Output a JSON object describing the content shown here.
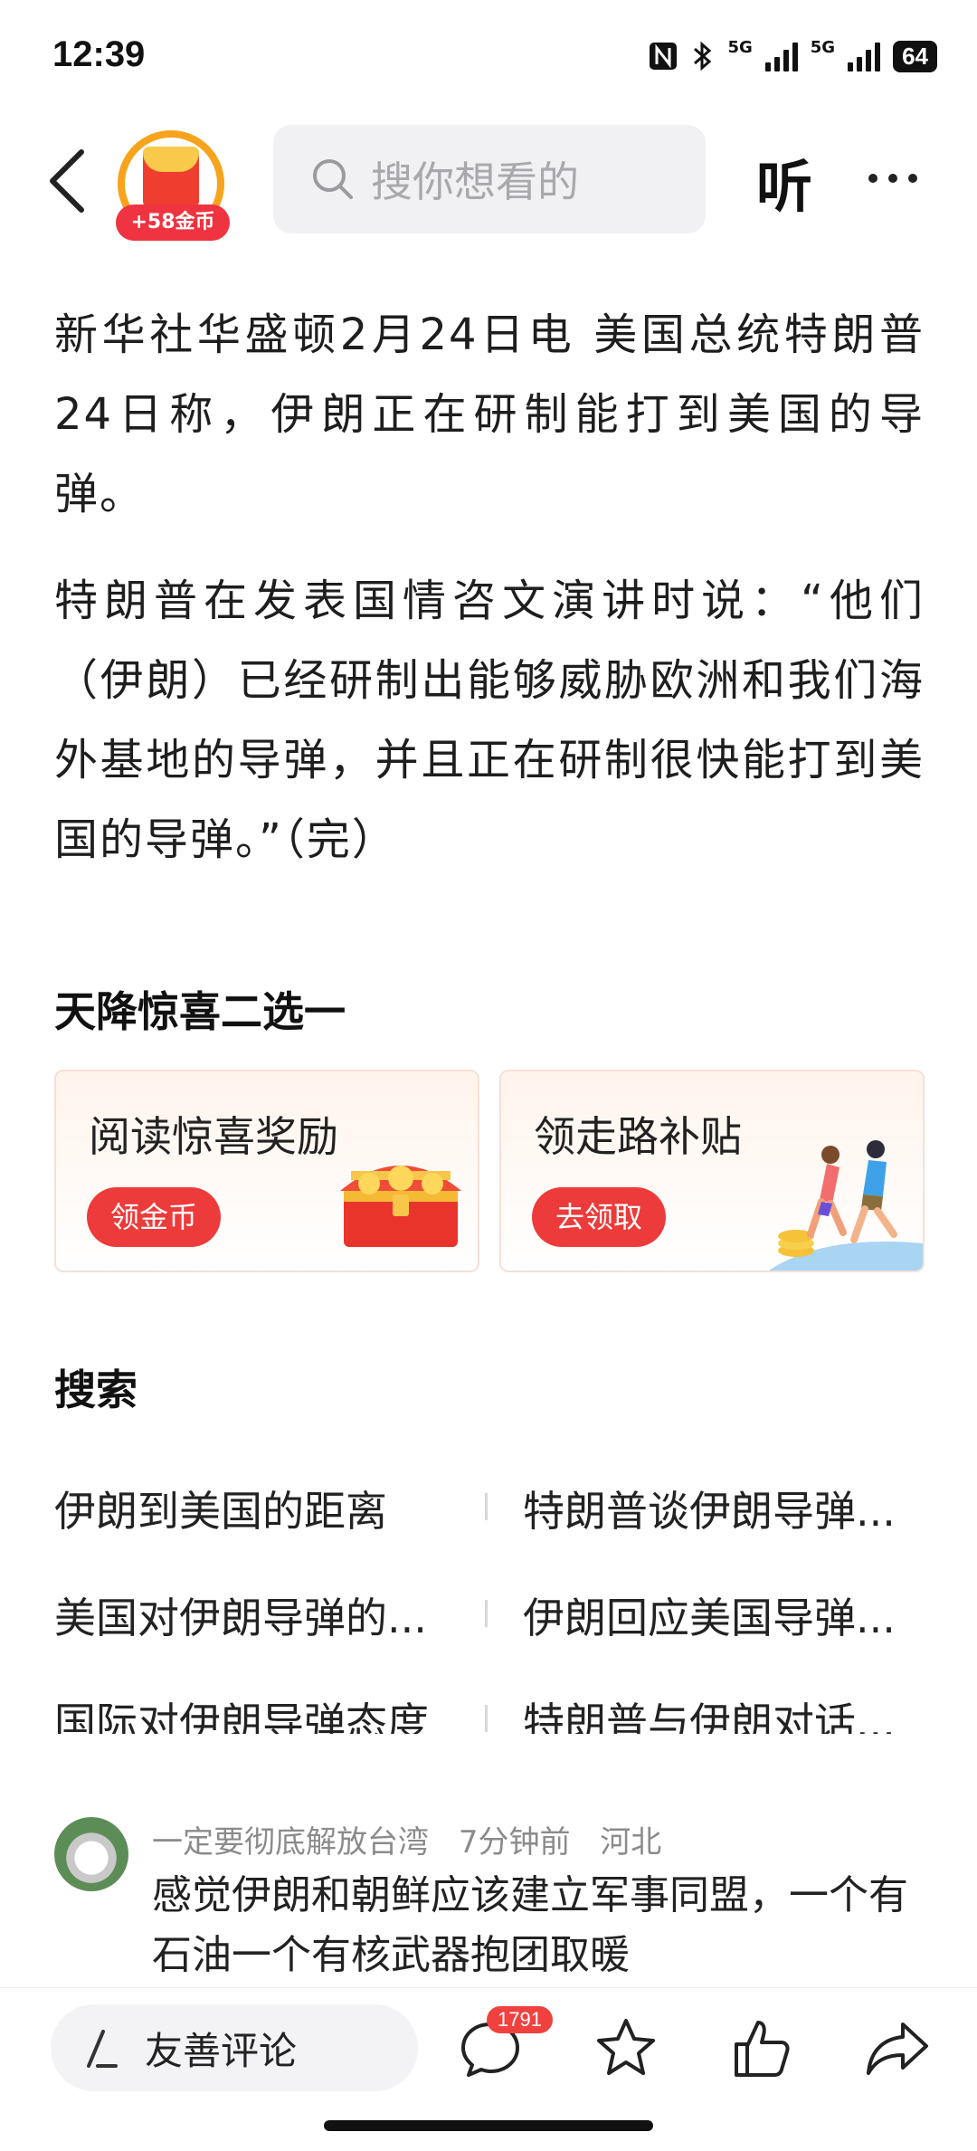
{
  "status": {
    "time": "12:39",
    "network1": "5G",
    "network2": "5G",
    "battery": "64"
  },
  "header": {
    "coin_badge": "+58金币",
    "search_placeholder": "搜你想看的",
    "listen_label": "听"
  },
  "article": {
    "paragraphs": [
      "新华社华盛顿2月24日电 美国总统特朗普24日称，伊朗正在研制能打到美国的导弹。",
      "特朗普在发表国情咨文演讲时说：“他们（伊朗）已经研制出能够威胁欧洲和我们海外基地的导弹，并且正在研制很快能打到美国的导弹。”（完）"
    ]
  },
  "surprise": {
    "title": "天降惊喜二选一",
    "cards": [
      {
        "title": "阅读惊喜奖励",
        "button": "领金币"
      },
      {
        "title": "领走路补贴",
        "button": "去领取"
      }
    ]
  },
  "search_section": {
    "title": "搜索",
    "items": [
      "伊朗到美国的距离",
      "特朗普谈伊朗导弹...",
      "美国对伊朗导弹的...",
      "伊朗回应美国导弹...",
      "国际对伊朗导弹态度",
      "特朗普与伊朗对话..."
    ]
  },
  "comment": {
    "user": "一定要彻底解放台湾",
    "time": "7分钟前",
    "location": "河北",
    "text": "感觉伊朗和朝鲜应该建立军事同盟，一个有石油一个有核武器抱团取暖"
  },
  "bottom_bar": {
    "comment_placeholder": "友善评论",
    "comment_count": "1791"
  }
}
